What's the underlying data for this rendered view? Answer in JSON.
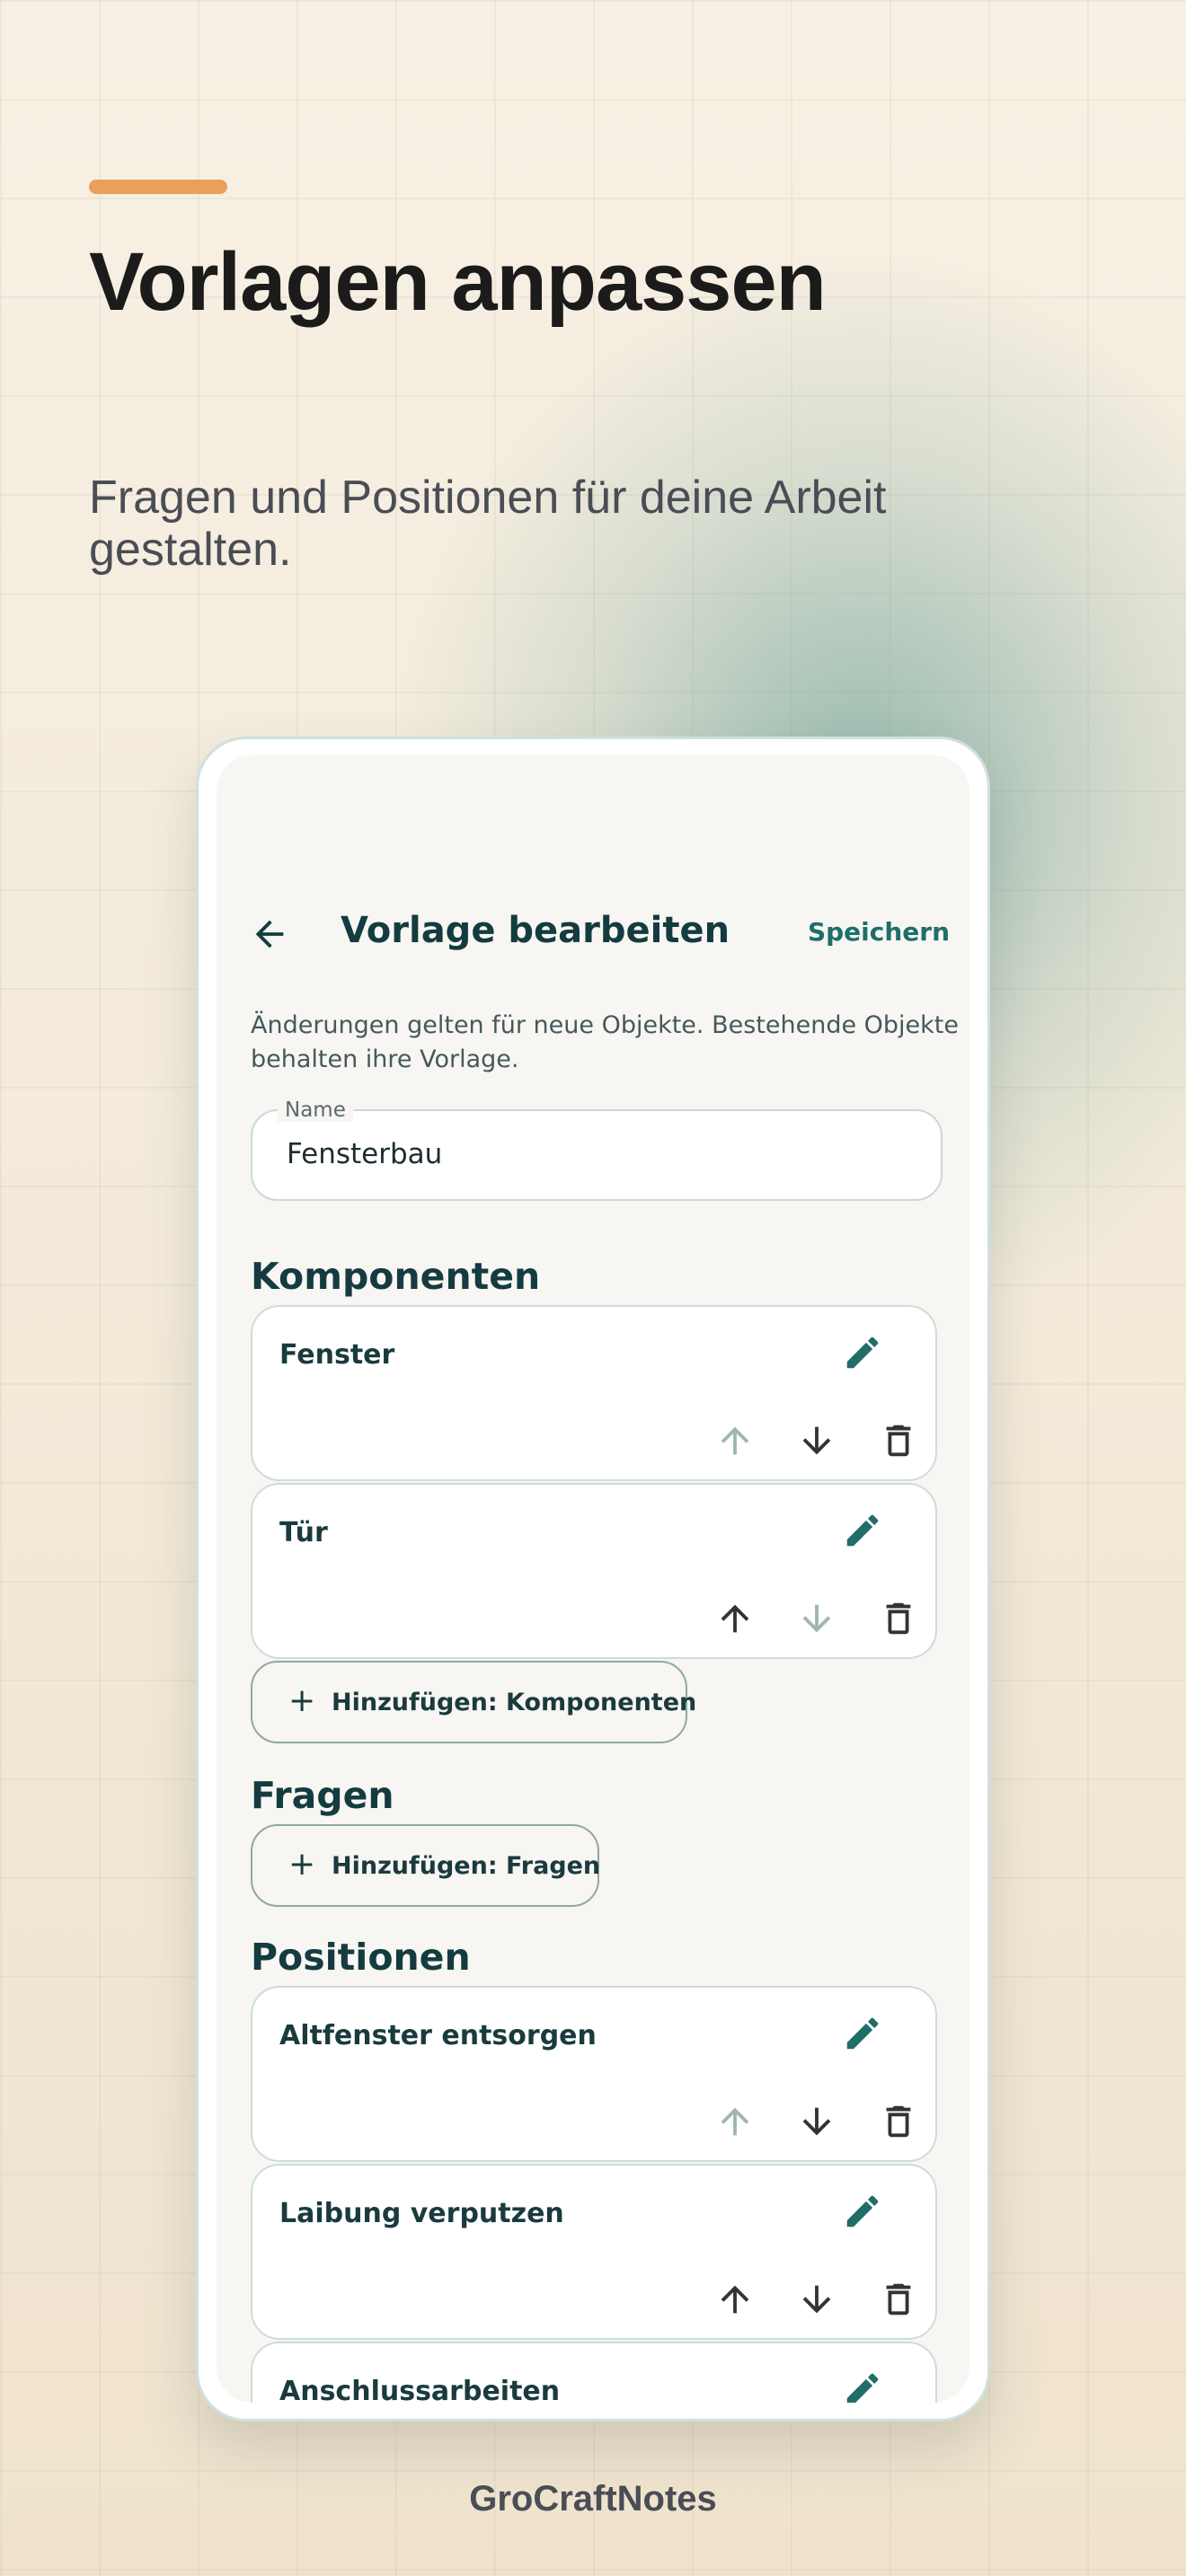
{
  "marketing": {
    "headline": "Vorlagen anpassen",
    "subtitle": "Fragen und Positionen für deine Arbeit gestalten.",
    "brand": "GroCraftNotes",
    "accent_color": "#e8a05a"
  },
  "app": {
    "title": "Vorlage bearbeiten",
    "save_label": "Speichern",
    "back_icon": "arrow-left-icon",
    "info_text": "Änderungen gelten für neue Objekte. Bestehende Objekte behalten ihre Vorlage.",
    "name_field": {
      "label": "Name",
      "value": "Fensterbau"
    },
    "sections": {
      "komponenten": {
        "title": "Komponenten",
        "items": [
          {
            "label": "Fenster",
            "up_enabled": false,
            "down_enabled": true
          },
          {
            "label": "Tür",
            "up_enabled": true,
            "down_enabled": false
          }
        ],
        "add_label": "Hinzufügen: Komponenten"
      },
      "fragen": {
        "title": "Fragen",
        "add_label": "Hinzufügen: Fragen"
      },
      "positionen": {
        "title": "Positionen",
        "items": [
          {
            "label": "Altfenster entsorgen",
            "up_enabled": false,
            "down_enabled": true
          },
          {
            "label": "Laibung verputzen",
            "up_enabled": true,
            "down_enabled": true
          },
          {
            "label": "Anschlussarbeiten"
          }
        ]
      }
    },
    "colors": {
      "primary": "#1f6e6a",
      "title": "#143c40",
      "icon_active": "#333333",
      "icon_disabled": "#9fb6b3"
    }
  }
}
